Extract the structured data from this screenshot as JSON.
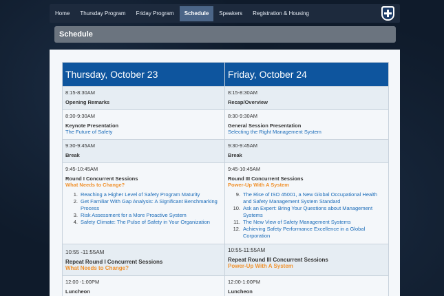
{
  "nav": {
    "items": [
      {
        "label": "Home",
        "active": false
      },
      {
        "label": "Thursday Program",
        "active": false
      },
      {
        "label": "Friday Program",
        "active": false
      },
      {
        "label": "Schedule",
        "active": true
      },
      {
        "label": "Speakers",
        "active": false
      },
      {
        "label": "Registration & Housing",
        "active": false
      }
    ]
  },
  "page": {
    "title": "Schedule"
  },
  "schedule": {
    "day1": "Thursday, October 23",
    "day2": "Friday, October 24",
    "rows": [
      {
        "t1": "8:15-8:30AM",
        "title1": "Opening Remarks",
        "t2": "8:15-8:30AM",
        "title2": "Recap/Overview"
      },
      {
        "t1": "8:30-9:30AM",
        "title1": "Keynote Presentation",
        "sub1": "The Future of Safety",
        "t2": "8:30-9:30AM",
        "title2": "General Session Presentation",
        "sub2": "Selecting the Right Management System"
      },
      {
        "t1": "9:30-9:45AM",
        "title1": "Break",
        "t2": "9:30-9:45AM",
        "title2": "Break"
      },
      {
        "t1": "9:45-10:45AM",
        "title1": "Round I Concurrent Sessions",
        "theme1": "What Needs to Change?",
        "list1": [
          {
            "n": "1.",
            "text": "Reaching a Higher Level of Safety Program Maturity"
          },
          {
            "n": "2.",
            "text": "Get Familiar With Gap Analysis: A Significant Benchmarking Process"
          },
          {
            "n": "3.",
            "text": "Risk Assessment for a More Proactive System"
          },
          {
            "n": "4.",
            "text": "Safety Climate: The Pulse of Safety in Your Organization"
          }
        ],
        "t2": "9:45-10:45AM",
        "title2": "Round III Concurrent Sessions",
        "theme2": "Power-Up With A System",
        "list2": [
          {
            "n": "9.",
            "text": "The Rise of ISO 45001, a New Global Occupational Health and Safety Management System Standard"
          },
          {
            "n": "10.",
            "text": "Ask an Expert: Bring Your Questions about Management Systems"
          },
          {
            "n": "11.",
            "text": "The New View of Safety Management Systems"
          },
          {
            "n": "12.",
            "text": "Achieving Safety Performance Excellence in a Global Corporation"
          }
        ]
      },
      {
        "t1": "10:55 -11:55AM",
        "title1": "Repeat Round I Concurrent Sessions",
        "theme1": "What Needs to Change?",
        "t2": "10:55-11:55AM",
        "title2": "Repeat Round III Concurrent Sessions",
        "theme2": "Power-Up With A System"
      },
      {
        "t1": "12:00 -1:00PM",
        "title1": "Luncheon",
        "t2": "12:00-1:00PM",
        "title2": "Luncheon"
      }
    ]
  }
}
